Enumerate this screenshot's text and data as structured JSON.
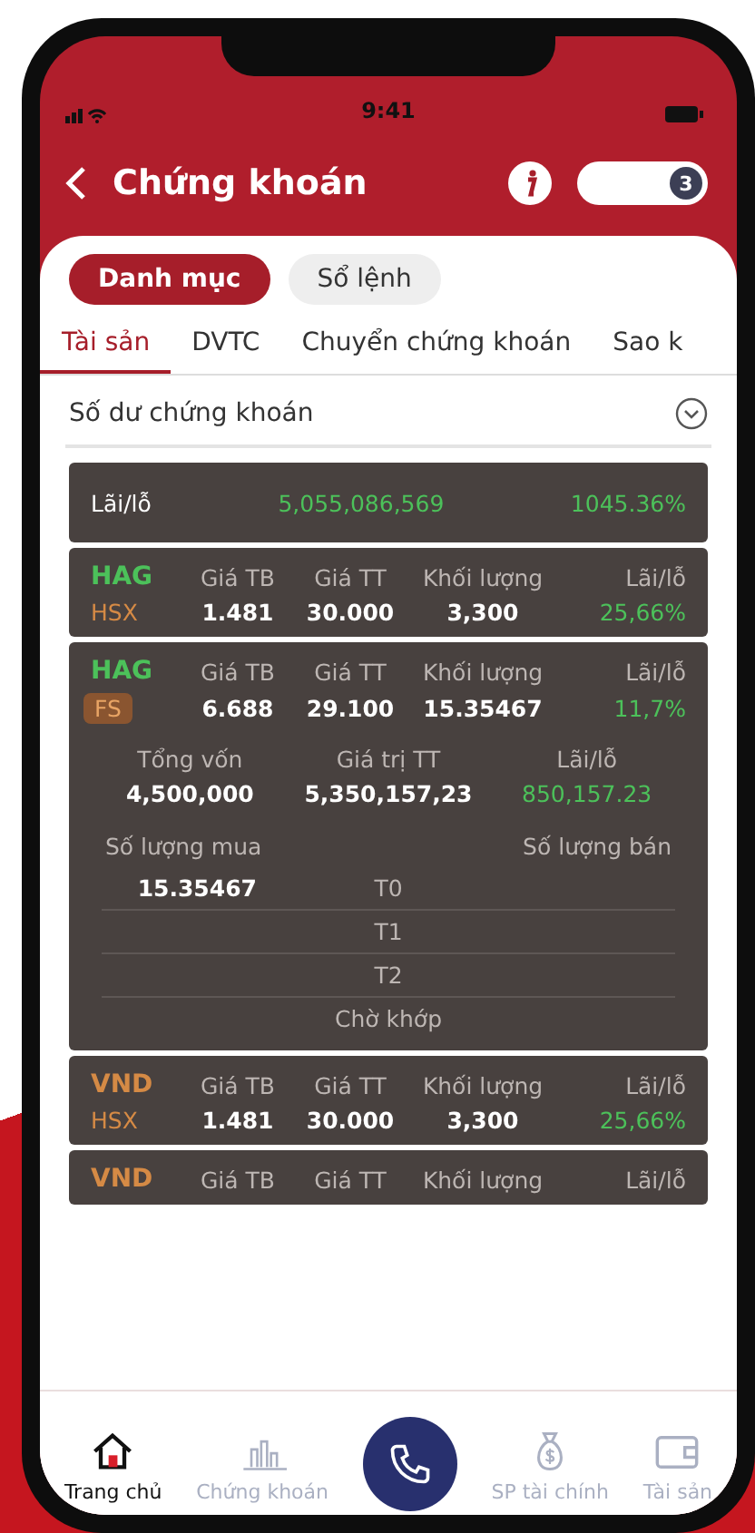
{
  "status_bar": {
    "time": "9:41"
  },
  "header": {
    "title": "Chứng khoán",
    "badge": "3"
  },
  "segments": [
    {
      "label": "Danh mục",
      "selected": true
    },
    {
      "label": "Sổ lệnh",
      "selected": false
    }
  ],
  "tabs": [
    {
      "label": "Tài sản",
      "selected": true
    },
    {
      "label": "DVTC",
      "selected": false
    },
    {
      "label": "Chuyển chứng khoán",
      "selected": false
    },
    {
      "label": "Sao k",
      "selected": false
    }
  ],
  "section": {
    "title": "Số dư chứng khoán"
  },
  "summary": {
    "label": "Lãi/lỗ",
    "amount": "5,055,086,569",
    "percent": "1045.36%"
  },
  "holdings": [
    {
      "kind": "text",
      "ticker": "HAG",
      "color": "#4cc15a",
      "exchange": "HSX",
      "labels": [
        "Giá TB",
        "Giá TT",
        "Khối lượng",
        "Lãi/lỗ"
      ],
      "avg_price": "1.481",
      "market_price": "30.000",
      "volume": "3,300",
      "pnl": "25,66%"
    },
    {
      "kind": "badge",
      "ticker": "HAG",
      "color": "#4cc15a",
      "exchange": "FS",
      "labels": [
        "Giá TB",
        "Giá TT",
        "Khối lượng",
        "Lãi/lỗ"
      ],
      "avg_price": "6.688",
      "market_price": "29.100",
      "volume": "15.35467",
      "pnl": "11,7%",
      "details": {
        "cost_label": "Tổng vốn",
        "cost": "4,500,000",
        "value_label": "Giá trị TT",
        "value": "5,350,157,23",
        "pnl_label": "Lãi/lỗ",
        "pnl": "850,157.23",
        "buy_label": "Số lượng mua",
        "sell_label": "Số lượng bán",
        "buy_qty": "15.35467",
        "rows": [
          "T0",
          "T1",
          "T2",
          "Chờ khớp"
        ]
      }
    },
    {
      "kind": "text",
      "ticker": "VND",
      "color": "#d58a45",
      "exchange": "HSX",
      "labels": [
        "Giá TB",
        "Giá TT",
        "Khối lượng",
        "Lãi/lỗ"
      ],
      "avg_price": "1.481",
      "market_price": "30.000",
      "volume": "3,300",
      "pnl": "25,66%"
    },
    {
      "ticker": "VND",
      "color": "#d58a45",
      "labels": [
        "Giá TB",
        "Giá TT",
        "Khối lượng",
        "Lãi/lỗ"
      ]
    }
  ],
  "nav": [
    {
      "kind": "home",
      "label": "Trang chủ",
      "selected": true
    },
    {
      "kind": "chart",
      "label": "Chứng khoán",
      "selected": false
    },
    {
      "kind": "call",
      "selected": false
    },
    {
      "kind": "money",
      "label": "SP tài chính",
      "selected": false
    },
    {
      "kind": "wallet",
      "label": "Tài sản",
      "selected": false
    }
  ]
}
